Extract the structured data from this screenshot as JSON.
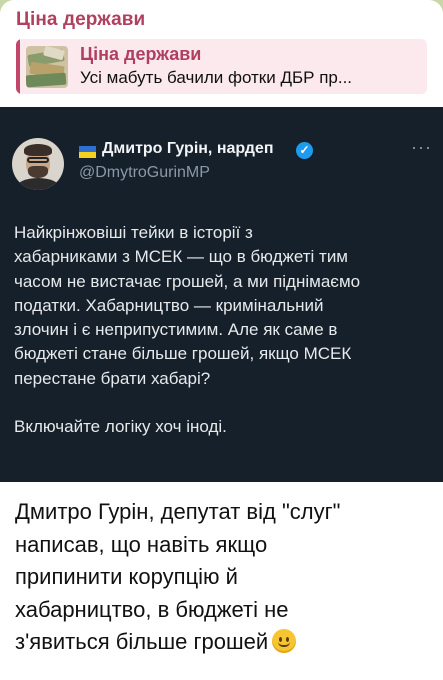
{
  "channel": {
    "name": "Ціна держави"
  },
  "reply": {
    "title": "Ціна держави",
    "text": "Усі мабуть бачили фотки ДБР пр..."
  },
  "tweet": {
    "author": "Дмитро Гурін, нардеп",
    "handle": "@DmytroGurinMP",
    "more": "···",
    "lines": [
      "Найкрінжовіші тейки в історії з",
      "хабарниками з МСЕК — що в бюджеті тим",
      "часом не вистачає грошей, а ми піднімаємо",
      "податки. Хабарництво — кримінальний",
      "злочин і є неприпустимим. Але як саме в",
      "бюджеті стане більше грошей, якщо МСЕК",
      "перестане брати хабарі?",
      "",
      "Включайте логіку хоч іноді."
    ]
  },
  "post": {
    "lines": [
      "Дмитро Гурін, депутат від \"слуг\"",
      "написав, що навіть якщо",
      "припинити корупцію й",
      "хабарництво, в бюджеті не",
      "з'явиться більше грошей"
    ],
    "emoji": "slightly-smiling-face-icon"
  },
  "colors": {
    "accent": "#b0405f",
    "tweet_bg": "#15202b",
    "verified": "#1d9bf0",
    "chat_bg": "#c9d6a8"
  }
}
